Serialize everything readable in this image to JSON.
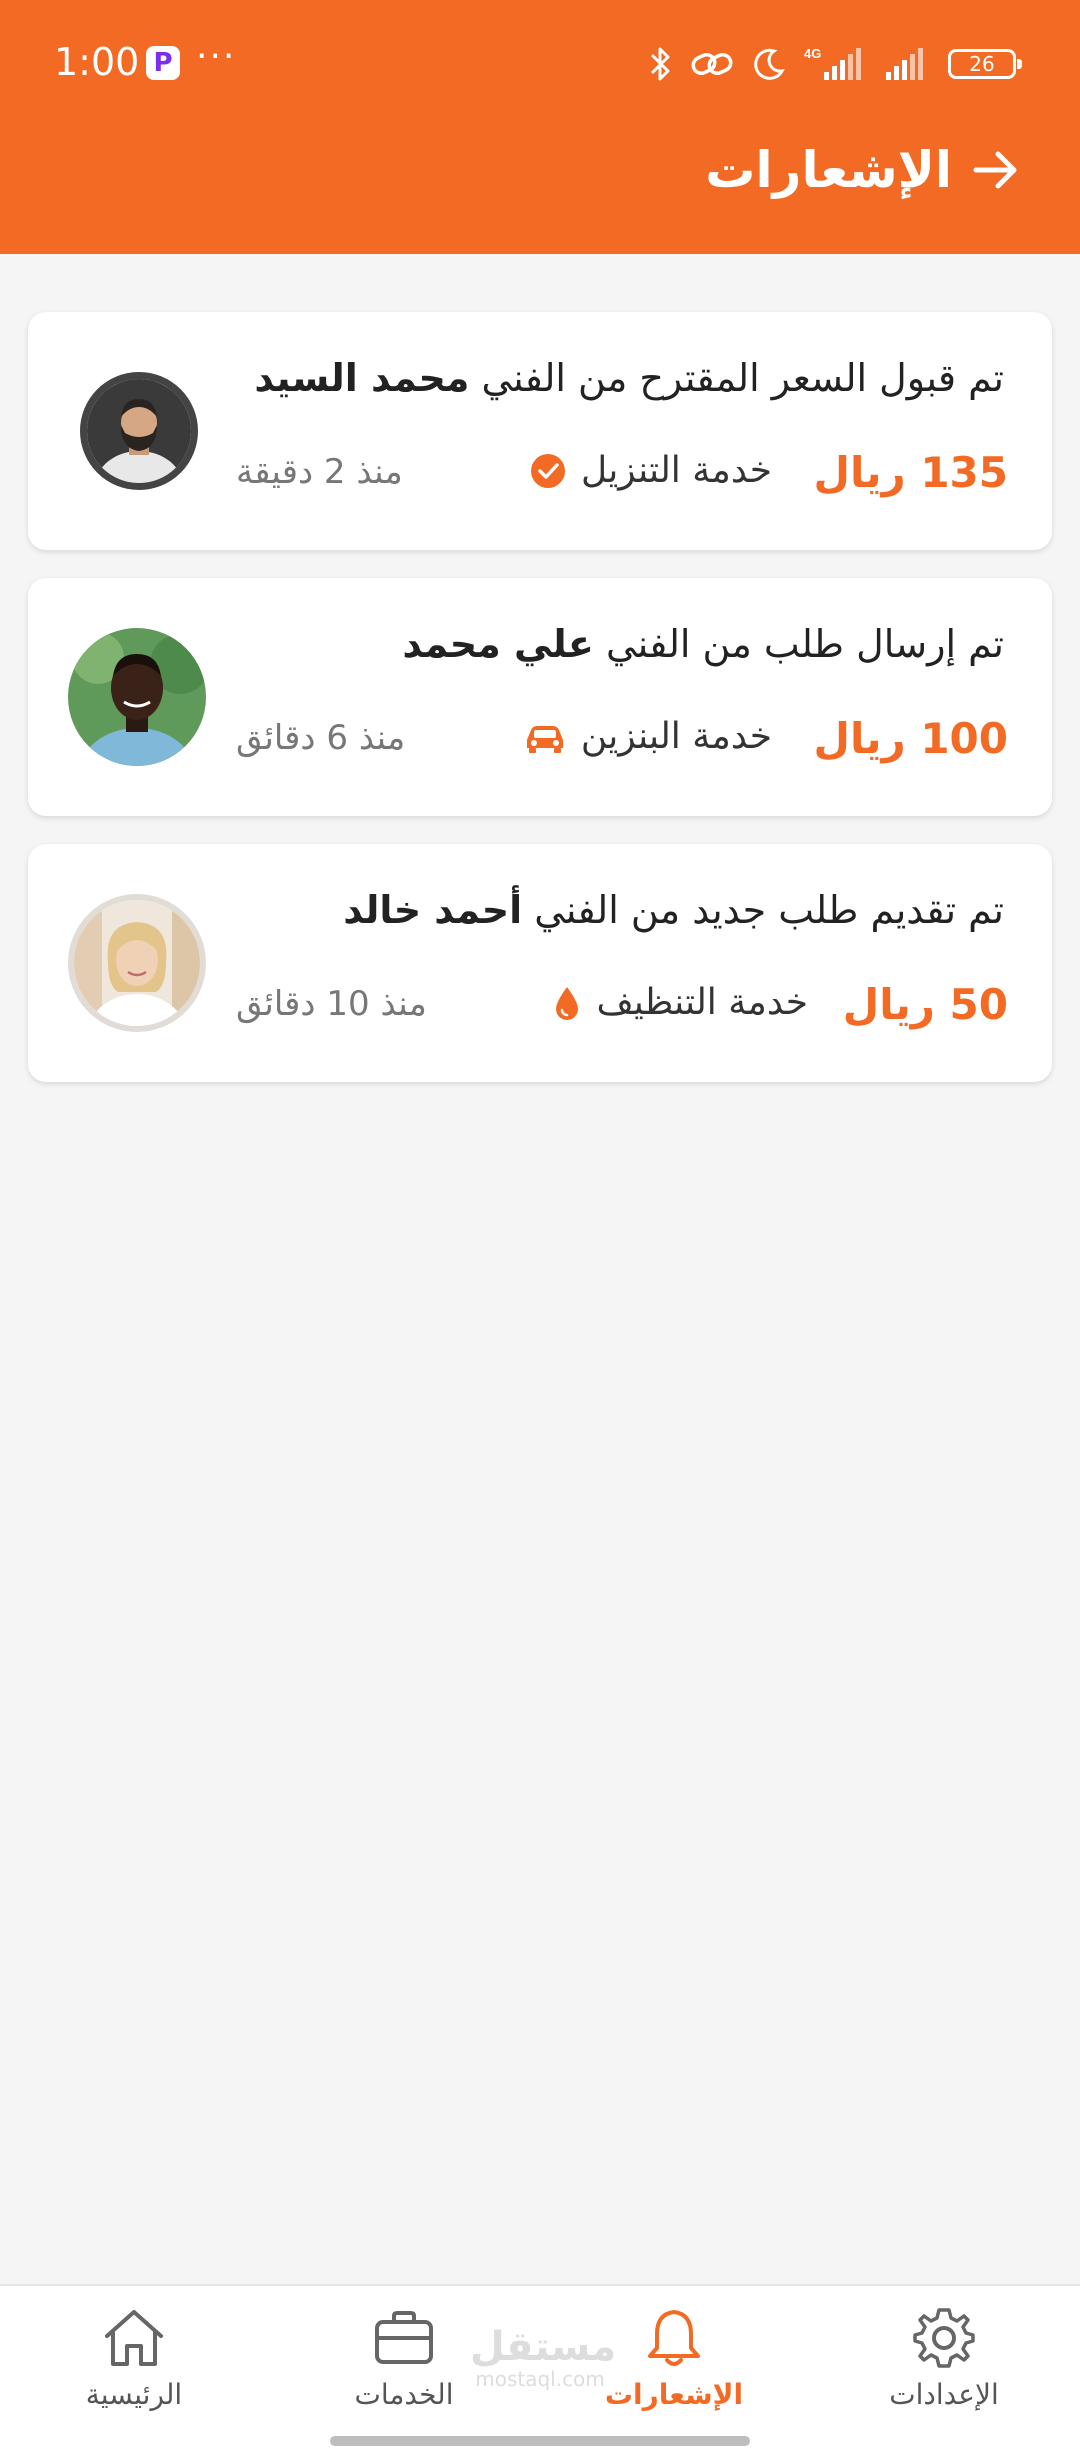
{
  "status_bar": {
    "time": "1:00",
    "app_icon": "P",
    "dots": "···",
    "network": "4G",
    "battery": "26"
  },
  "header": {
    "title": "الإشعارات",
    "back_icon": "arrow-right-icon"
  },
  "notifications": [
    {
      "prefix": "تم قبول السعر المقترح من الفني",
      "name": "محمد السيد",
      "price": "135 ريال",
      "service": "خدمة التنزيل",
      "service_icon": "check-circle-icon",
      "time": "منذ 2 دقيقة"
    },
    {
      "prefix": "تم إرسال طلب من الفني",
      "name": "علي محمد",
      "price": "100 ريال",
      "service": "خدمة البنزين",
      "service_icon": "car-icon",
      "time": "منذ 6 دقائق"
    },
    {
      "prefix": "تم تقديم طلب جديد من الفني",
      "name": "أحمد خالد",
      "price": "50 ريال",
      "service": "خدمة التنظيف",
      "service_icon": "drop-icon",
      "time": "منذ 10 دقائق"
    }
  ],
  "bottom_nav": {
    "items": [
      {
        "label": "الرئيسية",
        "icon": "home-icon",
        "active": false
      },
      {
        "label": "الخدمات",
        "icon": "briefcase-icon",
        "active": false
      },
      {
        "label": "الإشعارات",
        "icon": "bell-icon",
        "active": true
      },
      {
        "label": "الإعدادات",
        "icon": "gear-icon",
        "active": false
      }
    ]
  },
  "watermark": {
    "arabic": "مستقل",
    "latin": "mostaql.com"
  },
  "colors": {
    "accent": "#f26a23",
    "background": "#f5f5f5",
    "card": "#ffffff"
  }
}
